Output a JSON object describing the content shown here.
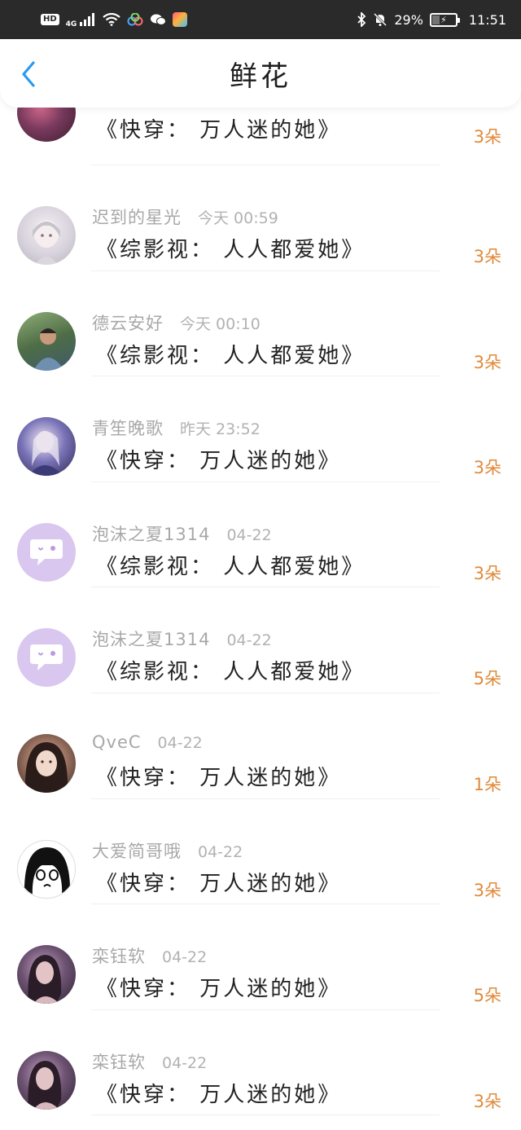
{
  "status_bar": {
    "hd_badge": "HD",
    "network": "4G",
    "battery_percent": "29%",
    "battery_level": 0.29,
    "time": "11:51"
  },
  "nav": {
    "back_icon": "chevron-left-icon",
    "title": "鲜花"
  },
  "colors": {
    "accent_blue": "#2a9af0",
    "count_orange": "#e08a3a"
  },
  "rows": [
    {
      "avatar": "flower-photo",
      "name": "",
      "time": "",
      "title": "《快穿： 万人迷的她》",
      "count": "3朵"
    },
    {
      "avatar": "anime-white-hair",
      "name": "迟到的星光",
      "time": "今天 00:59",
      "title": "《综影视： 人人都爱她》",
      "count": "3朵"
    },
    {
      "avatar": "boy-green",
      "name": "德云安好",
      "time": "今天 00:10",
      "title": "《综影视： 人人都爱她》",
      "count": "3朵"
    },
    {
      "avatar": "anime-blue",
      "name": "青笙晚歌",
      "time": "昨天 23:52",
      "title": "《快穿： 万人迷的她》",
      "count": "3朵"
    },
    {
      "avatar": "chat-default",
      "name": "泡沫之夏1314",
      "time": "04-22",
      "title": "《综影视： 人人都爱她》",
      "count": "3朵"
    },
    {
      "avatar": "chat-default",
      "name": "泡沫之夏1314",
      "time": "04-22",
      "title": "《综影视： 人人都爱她》",
      "count": "5朵"
    },
    {
      "avatar": "girl-dark",
      "name": "QveC",
      "time": "04-22",
      "title": "《快穿： 万人迷的她》",
      "count": "1朵"
    },
    {
      "avatar": "manga-girl",
      "name": "大爱简哥哦",
      "time": "04-22",
      "title": "《快穿： 万人迷的她》",
      "count": "3朵"
    },
    {
      "avatar": "girl-purple",
      "name": "栾钰软",
      "time": "04-22",
      "title": "《快穿： 万人迷的她》",
      "count": "5朵"
    },
    {
      "avatar": "girl-purple",
      "name": "栾钰软",
      "time": "04-22",
      "title": "《快穿： 万人迷的她》",
      "count": "3朵"
    }
  ]
}
